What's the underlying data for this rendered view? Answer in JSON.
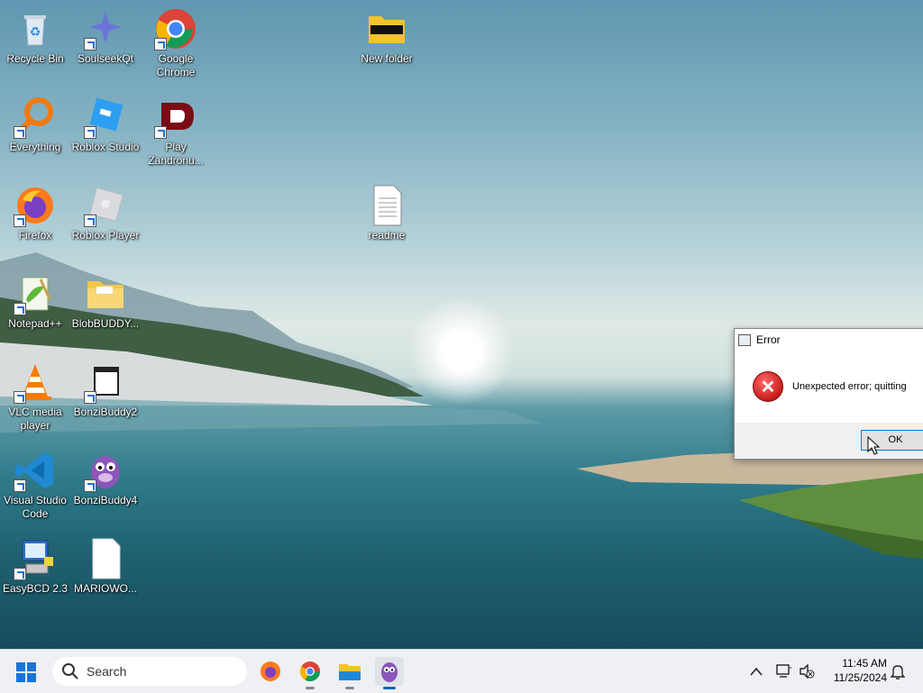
{
  "desktop": {
    "icons": [
      {
        "label": "Recycle Bin"
      },
      {
        "label": "SoulseekQt"
      },
      {
        "label": "Google Chrome"
      },
      {
        "label": "New folder"
      },
      {
        "label": "Everything"
      },
      {
        "label": "Roblox Studio"
      },
      {
        "label": "Play Zandronu..."
      },
      {
        "label": "Firefox"
      },
      {
        "label": "Roblox Player"
      },
      {
        "label": "readme"
      },
      {
        "label": "Notepad++"
      },
      {
        "label": "BlobBUDDY..."
      },
      {
        "label": "VLC media player"
      },
      {
        "label": "BonziBuddy2"
      },
      {
        "label": "Visual Studio Code"
      },
      {
        "label": "BonziBuddy4"
      },
      {
        "label": "EasyBCD 2.3"
      },
      {
        "label": "MARIOWO..."
      }
    ]
  },
  "dialog": {
    "title": "Error",
    "message": "Unexpected error; quitting",
    "ok_label": "OK"
  },
  "taskbar": {
    "search_placeholder": "Search",
    "time": "11:45 AM",
    "date": "11/25/2024",
    "apps": [
      "firefox-icon",
      "chrome-icon",
      "file-explorer-icon",
      "bonzibuddy-icon"
    ]
  },
  "colors": {
    "accent": "#0078d7",
    "error": "#c81b1b"
  }
}
